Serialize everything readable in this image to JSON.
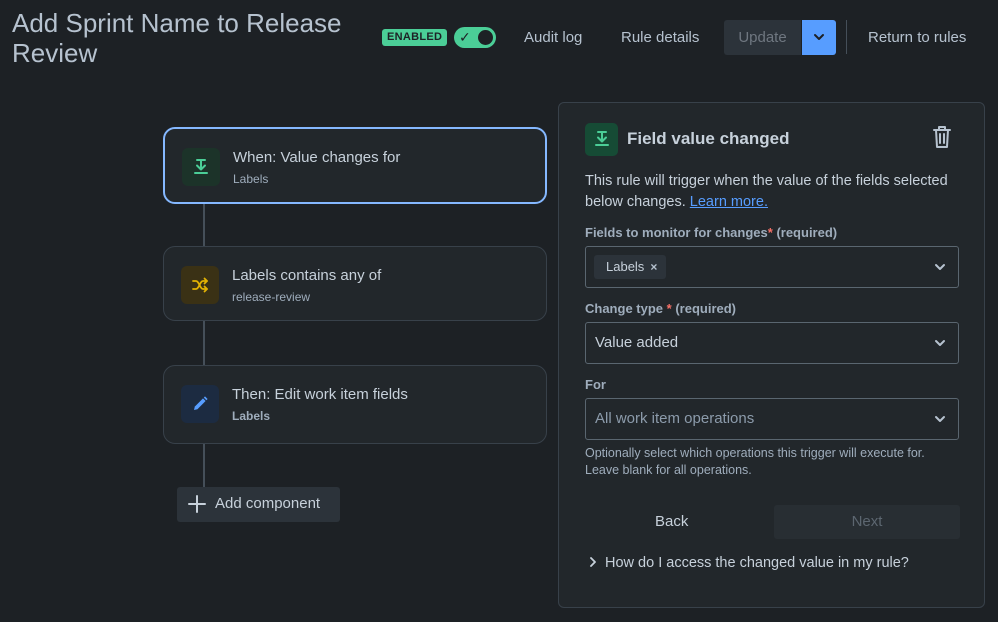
{
  "header": {
    "title": "Add Sprint Name to Release Review",
    "status_lozenge": "ENABLED",
    "toggle_on": true,
    "audit_log": "Audit log",
    "rule_details": "Rule details",
    "update": "Update",
    "return_to_rules": "Return to rules"
  },
  "flow": {
    "trigger": {
      "title": "When: Value changes for",
      "subtitle": "Labels",
      "icon": "trigger-download-icon"
    },
    "condition": {
      "title": "Labels contains any of",
      "subtitle": "release-review",
      "icon": "shuffle-icon"
    },
    "action": {
      "title": "Then: Edit work item fields",
      "subtitle": "Labels",
      "icon": "pencil-icon"
    },
    "add_component": "Add component"
  },
  "panel": {
    "title": "Field value changed",
    "description": "This rule will trigger when the value of the fields selected below changes.",
    "learn_more": "Learn more.",
    "fields_label": "Fields to monitor for changes",
    "required_marker": "*",
    "required_text": "(required)",
    "fields_tag": "Labels",
    "change_type_label": "Change type",
    "change_type_value": "Value added",
    "for_label": "For",
    "for_placeholder": "All work item operations",
    "help_text": "Optionally select which operations this trigger will execute for. Leave blank for all operations.",
    "back": "Back",
    "next": "Next",
    "faq": "How do I access the changed value in my rule?"
  },
  "colors": {
    "background": "#1d2125",
    "accent": "#579dff",
    "success": "#4bce97",
    "selected_border": "#85b8ff"
  }
}
